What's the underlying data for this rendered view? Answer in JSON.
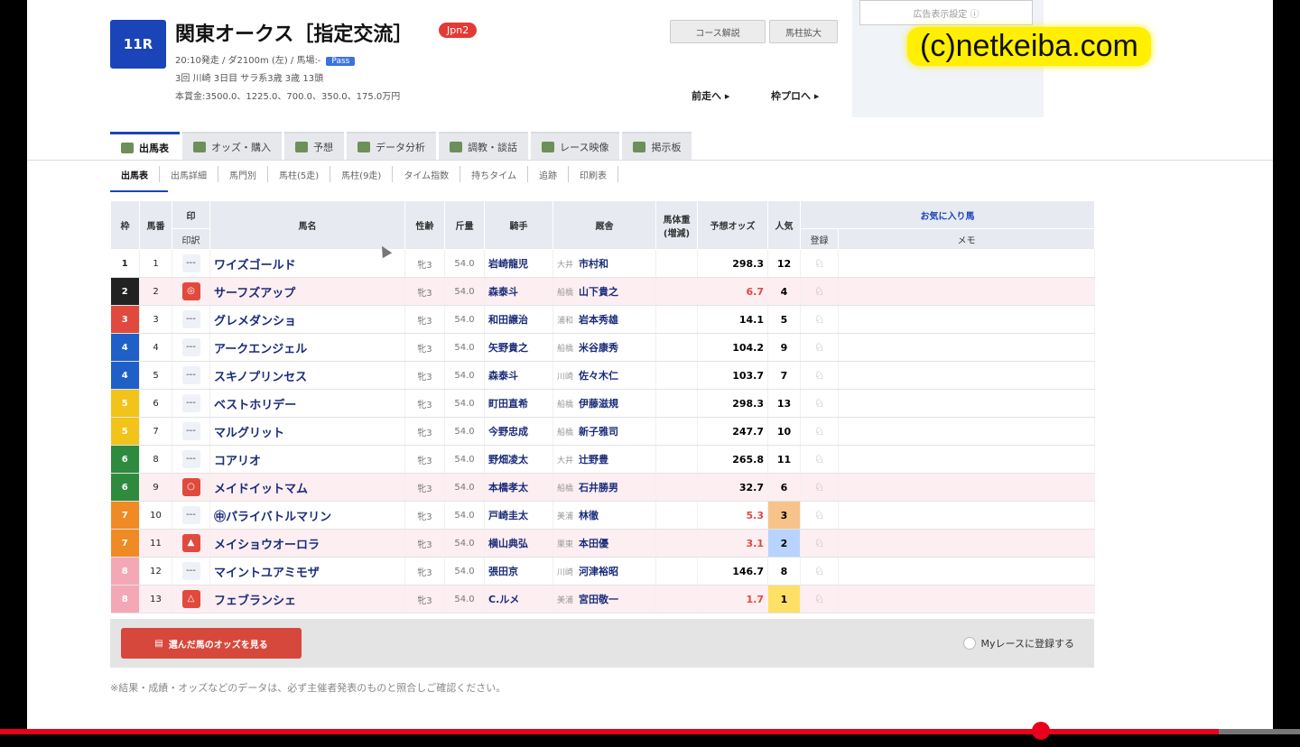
{
  "race": {
    "number": "11R",
    "name": "関東オークス［指定交流］",
    "grade": "Jpn2",
    "line1": "20:10発走 / ダ2100m (左) / 馬場:-",
    "line1_tag": "Pass",
    "line2": "3回 川崎 3日目 サラ系3歳 3歳          13頭",
    "line3": "本賞金:3500.0、1225.0、700.0、350.0、175.0万円"
  },
  "header_buttons": {
    "course": "コース解説",
    "horse_list": "馬柱拡大"
  },
  "nav": {
    "prev": "前走へ ▸",
    "next": "枠プロへ ▸"
  },
  "ad": {
    "label": "広告表示設定 ⓘ"
  },
  "watermark": "(c)netkeiba.com",
  "tabs": [
    {
      "label": "出馬表",
      "icon": "table-icon"
    },
    {
      "label": "オッズ・購入",
      "icon": "ticket-icon"
    },
    {
      "label": "予想",
      "icon": "target-icon"
    },
    {
      "label": "データ分析",
      "icon": "chart-icon"
    },
    {
      "label": "調教・談話",
      "icon": "horse-icon"
    },
    {
      "label": "レース映像",
      "icon": "video-icon"
    },
    {
      "label": "掲示板",
      "icon": "board-icon"
    }
  ],
  "subtabs": [
    "出馬表",
    "出馬詳細",
    "馬門別",
    "馬柱(5走)",
    "馬柱(9走)",
    "タイム指数",
    "持ちタイム",
    "追跡",
    "印刷表"
  ],
  "columns": {
    "waku": "枠",
    "umaban": "馬番",
    "mark": "印",
    "mark_sub": "印訳",
    "horse": "馬名",
    "sex_age": "性齢",
    "weight": "斤量",
    "jockey": "騎手",
    "trainer": "厩舎",
    "body_weight": "馬体重(増減)",
    "odds": "予想オッズ",
    "pop": "人気",
    "fav_group": "お気に入り馬",
    "fav_sub": "登録",
    "memo": "メモ"
  },
  "waku_colors": {
    "1": {
      "bg": "#ffffff",
      "fg": "#222222"
    },
    "2": {
      "bg": "#222222",
      "fg": "#ffffff"
    },
    "3": {
      "bg": "#e04a3e",
      "fg": "#ffffff"
    },
    "4": {
      "bg": "#1f5fc8",
      "fg": "#ffffff"
    },
    "5": {
      "bg": "#f2c318",
      "fg": "#ffffff"
    },
    "6": {
      "bg": "#2e8b3d",
      "fg": "#ffffff"
    },
    "7": {
      "bg": "#f08a24",
      "fg": "#ffffff"
    },
    "8": {
      "bg": "#f4a8b6",
      "fg": "#ffffff"
    }
  },
  "rows": [
    {
      "waku": "1",
      "umaban": "1",
      "mark": "---",
      "horse": "ワイズゴールド",
      "sex": "牝3",
      "kin": "54.0",
      "jockey": "岩崎龍児",
      "loc": "大井",
      "trainer": "市村和",
      "odds": "298.3",
      "pop": "12",
      "pink": false,
      "markStyle": "",
      "oddsHot": false,
      "popClass": ""
    },
    {
      "waku": "2",
      "umaban": "2",
      "mark": "◎",
      "horse": "サーフズアップ",
      "sex": "牝3",
      "kin": "54.0",
      "jockey": "森泰斗",
      "loc": "船橋",
      "trainer": "山下貴之",
      "odds": "6.7",
      "pop": "4",
      "pink": true,
      "markStyle": "circle",
      "oddsHot": true,
      "popClass": ""
    },
    {
      "waku": "3",
      "umaban": "3",
      "mark": "---",
      "horse": "グレメダンショ",
      "sex": "牝3",
      "kin": "54.0",
      "jockey": "和田譲治",
      "loc": "浦和",
      "trainer": "岩本秀雄",
      "odds": "14.1",
      "pop": "5",
      "pink": false,
      "markStyle": "",
      "oddsHot": false,
      "popClass": ""
    },
    {
      "waku": "4",
      "umaban": "4",
      "mark": "---",
      "horse": "アークエンジェル",
      "sex": "牝3",
      "kin": "54.0",
      "jockey": "矢野貴之",
      "loc": "船橋",
      "trainer": "米谷康秀",
      "odds": "104.2",
      "pop": "9",
      "pink": false,
      "markStyle": "",
      "oddsHot": false,
      "popClass": ""
    },
    {
      "waku": "4",
      "umaban": "5",
      "mark": "---",
      "horse": "スキノプリンセス",
      "sex": "牝3",
      "kin": "54.0",
      "jockey": "森泰斗",
      "loc": "川崎",
      "trainer": "佐々木仁",
      "odds": "103.7",
      "pop": "7",
      "pink": false,
      "markStyle": "",
      "oddsHot": false,
      "popClass": ""
    },
    {
      "waku": "5",
      "umaban": "6",
      "mark": "---",
      "horse": "ベストホリデー",
      "sex": "牝3",
      "kin": "54.0",
      "jockey": "町田直希",
      "loc": "船橋",
      "trainer": "伊藤滋規",
      "odds": "298.3",
      "pop": "13",
      "pink": false,
      "markStyle": "",
      "oddsHot": false,
      "popClass": ""
    },
    {
      "waku": "5",
      "umaban": "7",
      "mark": "---",
      "horse": "マルグリット",
      "sex": "牝3",
      "kin": "54.0",
      "jockey": "今野忠成",
      "loc": "船橋",
      "trainer": "新子雅司",
      "odds": "247.7",
      "pop": "10",
      "pink": false,
      "markStyle": "",
      "oddsHot": false,
      "popClass": ""
    },
    {
      "waku": "6",
      "umaban": "8",
      "mark": "---",
      "horse": "コアリオ",
      "sex": "牝3",
      "kin": "54.0",
      "jockey": "野畑凌太",
      "loc": "大井",
      "trainer": "辻野豊",
      "odds": "265.8",
      "pop": "11",
      "pink": false,
      "markStyle": "",
      "oddsHot": false,
      "popClass": ""
    },
    {
      "waku": "6",
      "umaban": "9",
      "mark": "○",
      "horse": "メイドイットマム",
      "sex": "牝3",
      "kin": "54.0",
      "jockey": "本橋孝太",
      "loc": "船橋",
      "trainer": "石井勝男",
      "odds": "32.7",
      "pop": "6",
      "pink": true,
      "markStyle": "circle",
      "oddsHot": false,
      "popClass": ""
    },
    {
      "waku": "7",
      "umaban": "10",
      "mark": "---",
      "horse": "㊥パライバトルマリン",
      "sex": "牝3",
      "kin": "54.0",
      "jockey": "戸崎圭太",
      "loc": "美浦",
      "trainer": "林徹",
      "odds": "5.3",
      "pop": "3",
      "pink": false,
      "markStyle": "",
      "oddsHot": true,
      "popClass": "p3"
    },
    {
      "waku": "7",
      "umaban": "11",
      "mark": "▲",
      "horse": "メイショウオーロラ",
      "sex": "牝3",
      "kin": "54.0",
      "jockey": "横山典弘",
      "loc": "栗東",
      "trainer": "本田優",
      "odds": "3.1",
      "pop": "2",
      "pink": true,
      "markStyle": "circle",
      "oddsHot": true,
      "popClass": "p2"
    },
    {
      "waku": "8",
      "umaban": "12",
      "mark": "---",
      "horse": "マイントユアミモザ",
      "sex": "牝3",
      "kin": "54.0",
      "jockey": "張田京",
      "loc": "川崎",
      "trainer": "河津裕昭",
      "odds": "146.7",
      "pop": "8",
      "pink": false,
      "markStyle": "",
      "oddsHot": false,
      "popClass": ""
    },
    {
      "waku": "8",
      "umaban": "13",
      "mark": "△",
      "horse": "フェブランシェ",
      "sex": "牝3",
      "kin": "54.0",
      "jockey": "C.ルメ",
      "loc": "美浦",
      "trainer": "宮田敬一",
      "odds": "1.7",
      "pop": "1",
      "pink": true,
      "markStyle": "circle",
      "oddsHot": true,
      "popClass": "p1"
    }
  ],
  "footer": {
    "vote_label": "選んだ馬のオッズを見る",
    "myrace_label": "Myレースに登録する"
  },
  "note": "※結果・成績・オッズなどのデータは、必ず主催者発表のものと照合しご確認ください。",
  "progress": 0.94
}
